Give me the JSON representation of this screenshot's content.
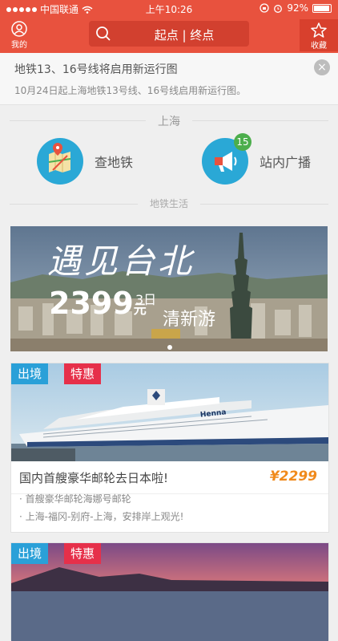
{
  "status": {
    "carrier": "中国联通",
    "time": "上午10:26",
    "battery": "92%"
  },
  "nav": {
    "mine_label": "我的",
    "search_placeholder": "起点 | 终点",
    "fav_label": "收藏"
  },
  "notice": {
    "title": "地铁13、16号线将启用新运行图",
    "desc": "10月24日起上海地铁13号线、16号线启用新运行图。",
    "close_glyph": "×"
  },
  "city": {
    "name": "上海"
  },
  "entries": [
    {
      "label": "查地铁"
    },
    {
      "label": "站内广播",
      "badge": "15"
    }
  ],
  "section_title": "地铁生活",
  "banner": {
    "title": "遇见台北",
    "price": "2399",
    "unit": "元",
    "days": "3日",
    "tour": "清新游"
  },
  "cards": [
    {
      "tag1": "出境",
      "tag2": "特惠",
      "name": "国内首艘豪华邮轮去日本啦!",
      "price": "¥2299",
      "lines": [
        "· 首艘豪华邮轮海娜号邮轮",
        "· 上海-福冈-别府-上海，安排岸上观光!"
      ],
      "ship_name": "Henna"
    },
    {
      "tag1": "出境",
      "tag2": "特惠"
    }
  ],
  "colors": {
    "brand": "#e8523e",
    "accent_blue": "#2aa0d8",
    "tag_red": "#e6304a",
    "price_orange": "#f08a1c"
  }
}
